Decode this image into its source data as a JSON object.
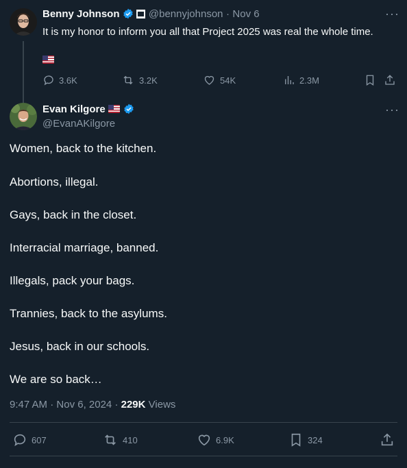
{
  "parent": {
    "name": "Benny Johnson",
    "handle": "@bennyjohnson",
    "sep": "·",
    "date": "Nov 6",
    "text": "It is my honor to inform you all that Project 2025 was real the whole time.",
    "stats": {
      "replies": "3.6K",
      "reposts": "3.2K",
      "likes": "54K",
      "views": "2.3M"
    }
  },
  "tweet": {
    "name": "Evan Kilgore",
    "handle": "@EvanAKilgore",
    "lines": [
      "Women, back to the kitchen.",
      "Abortions, illegal.",
      "Gays, back in the closet.",
      "Interracial marriage, banned.",
      "Illegals, pack your bags.",
      "Trannies, back to the asylums.",
      "Jesus, back in our schools.",
      "We are so back…"
    ],
    "time": "9:47 AM",
    "sep": "·",
    "date": "Nov 6, 2024",
    "sep2": "·",
    "views_count": "229K",
    "views_label": "Views",
    "stats": {
      "replies": "607",
      "reposts": "410",
      "likes": "6.9K",
      "bookmarks": "324"
    }
  },
  "icons": [
    "reply-icon",
    "repost-icon",
    "like-icon",
    "views-icon",
    "bookmark-icon",
    "share-icon",
    "more-icon",
    "verified-icon"
  ],
  "colors": {
    "background": "#15202b",
    "text": "#f7f9f9",
    "muted": "#8b98a5",
    "verified": "#1d9bf0",
    "divider": "#38444d"
  }
}
